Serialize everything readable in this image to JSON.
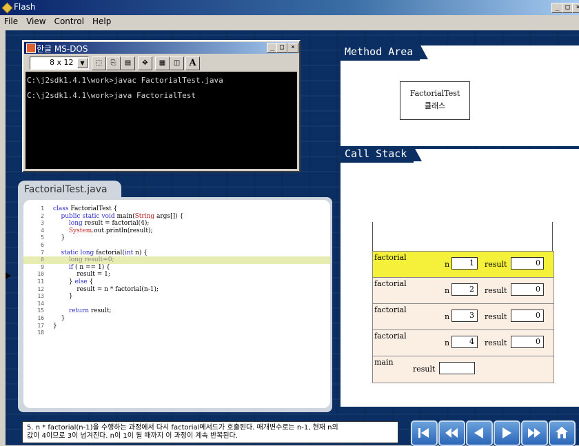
{
  "window": {
    "title": "Flash",
    "min_label": "_",
    "max_label": "□",
    "close_label": "×"
  },
  "menu": [
    "File",
    "View",
    "Control",
    "Help"
  ],
  "dos": {
    "title": "한글 MS-DOS",
    "font_size": "8 x 12",
    "lines": [
      "C:\\j2sdk1.4.1\\work>javac FactorialTest.java",
      "C:\\j2sdk1.4.1\\work>java FactorialTest"
    ]
  },
  "editor": {
    "tab_label": "FactorialTest.java",
    "current_line": 8,
    "lines": [
      {
        "n": "1",
        "text": "class FactorialTest {"
      },
      {
        "n": "2",
        "text": "    public static void main(String args[]) {"
      },
      {
        "n": "3",
        "text": "        long result = factorial(4);"
      },
      {
        "n": "4",
        "text": "        System.out.println(result);"
      },
      {
        "n": "5",
        "text": "    }"
      },
      {
        "n": "6",
        "text": ""
      },
      {
        "n": "7",
        "text": "    static long factorial(int n) {"
      },
      {
        "n": "8",
        "text": "        long result=0;"
      },
      {
        "n": "9",
        "text": "        if ( n == 1) {"
      },
      {
        "n": "10",
        "text": "            result = 1;"
      },
      {
        "n": "11",
        "text": "        } else {"
      },
      {
        "n": "12",
        "text": "            result = n * factorial(n-1);"
      },
      {
        "n": "13",
        "text": "        }"
      },
      {
        "n": "14",
        "text": ""
      },
      {
        "n": "15",
        "text": "        return result;"
      },
      {
        "n": "16",
        "text": "    }"
      },
      {
        "n": "17",
        "text": "}"
      },
      {
        "n": "18",
        "text": ""
      }
    ]
  },
  "method_area": {
    "title": "Method Area",
    "class_name": "FactorialTest",
    "class_suffix": "클래스"
  },
  "call_stack": {
    "title": "Call Stack",
    "n_label": "n",
    "result_label": "result",
    "frames": [
      {
        "name": "factorial",
        "n": "1",
        "result": "0",
        "active": true
      },
      {
        "name": "factorial",
        "n": "2",
        "result": "0",
        "active": false
      },
      {
        "name": "factorial",
        "n": "3",
        "result": "0",
        "active": false
      },
      {
        "name": "factorial",
        "n": "4",
        "result": "0",
        "active": false
      }
    ],
    "main": {
      "name": "main",
      "result": ""
    }
  },
  "status": {
    "line1": "5. n * factorial(n-1)을 수행하는 과정에서 다시 factorial메서드가 호출된다. 매개변수로는 n-1, 현재 n의",
    "line2": "값이 4이므로 3이 넘겨진다. n이 1이 될 때까지 이 과정이 계속 반복된다."
  },
  "nav": [
    "first-icon",
    "rewind-icon",
    "previous-icon",
    "next-icon",
    "fast-forward-icon",
    "home-icon"
  ],
  "colors": {
    "background": "#0b2f63",
    "highlight_line": "#e7ecb2",
    "active_frame": "#f5f03a",
    "frame": "#fbeee3",
    "nav_button": "#3c78c8"
  }
}
